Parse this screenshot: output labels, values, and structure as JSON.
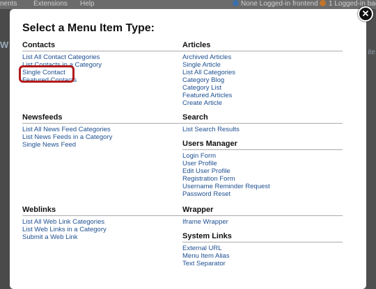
{
  "background": {
    "topbar": {
      "nav_left": "nents",
      "nav_extensions": "Extensions",
      "nav_help": "Help",
      "status_frontend": "None Logged-in frontend",
      "status_backend": "1 Logged-in bac"
    }
  },
  "modal": {
    "title": "Select a Menu Item Type:",
    "close_glyph": "✕",
    "groups": {
      "contacts": {
        "title": "Contacts",
        "items": [
          "List All Contact Categories",
          "List Contacts in a Category",
          "Single Contact",
          "Featured Contacts"
        ]
      },
      "newsfeeds": {
        "title": "Newsfeeds",
        "items": [
          "List All News Feed Categories",
          "List News Feeds in a Category",
          "Single News Feed"
        ]
      },
      "weblinks": {
        "title": "Weblinks",
        "items": [
          "List All Web Link Categories",
          "List Web Links in a Category",
          "Submit a Web Link"
        ]
      },
      "articles": {
        "title": "Articles",
        "items": [
          "Archived Articles",
          "Single Article",
          "List All Categories",
          "Category Blog",
          "Category List",
          "Featured Articles",
          "Create Article"
        ]
      },
      "search": {
        "title": "Search",
        "items": [
          "List Search Results"
        ]
      },
      "users": {
        "title": "Users Manager",
        "items": [
          "Login Form",
          "User Profile",
          "Edit User Profile",
          "Registration Form",
          "Username Reminder Request",
          "Password Reset"
        ]
      },
      "wrapper": {
        "title": "Wrapper",
        "items": [
          "Iframe Wrapper"
        ]
      },
      "system": {
        "title": "System Links",
        "items": [
          "External URL",
          "Menu Item Alias",
          "Text Separator"
        ]
      }
    }
  },
  "colors": {
    "link": "#1d4f91",
    "highlight": "#b11a1a"
  }
}
